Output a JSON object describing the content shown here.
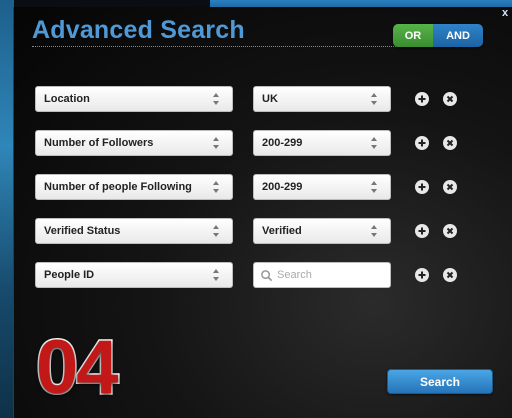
{
  "dialog": {
    "title": "Advanced Search",
    "close_label": "x",
    "toggle": {
      "or_label": "OR",
      "and_label": "AND"
    }
  },
  "rows": [
    {
      "field": "Location",
      "value": "UK"
    },
    {
      "field": "Number of Followers",
      "value": "200-299"
    },
    {
      "field": "Number of people Following",
      "value": "200-299"
    },
    {
      "field": "Verified Status",
      "value": "Verified"
    },
    {
      "field": "People ID",
      "value": "",
      "placeholder": "Search"
    }
  ],
  "step_number": "04",
  "search_button_label": "Search",
  "colors": {
    "title": "#4f9ad6",
    "or_toggle": "#58b34b",
    "and_toggle": "#2f83c9",
    "step_number": "#c21818",
    "search_button": "#2674b8"
  },
  "icons": {
    "select_arrows": "updown-arrows-icon",
    "add": "plus-icon",
    "remove": "x-icon",
    "search": "magnifier-icon"
  }
}
